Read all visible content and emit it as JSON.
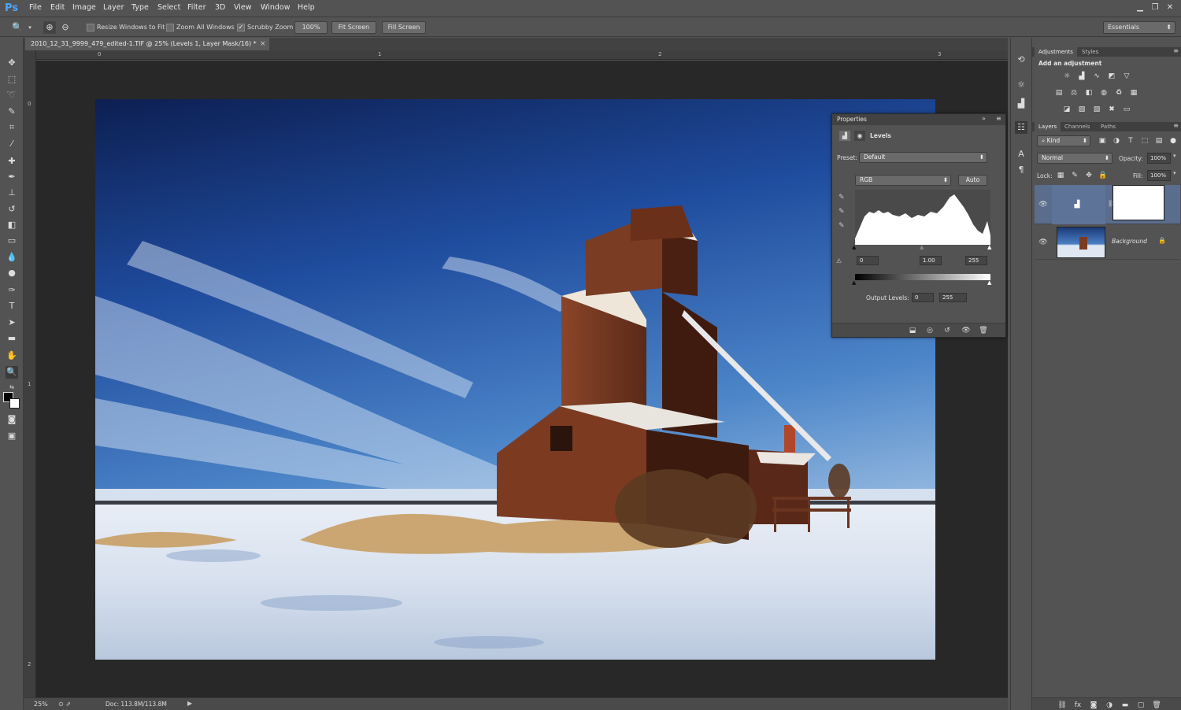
{
  "app": {
    "logo": "Ps"
  },
  "menu": [
    "File",
    "Edit",
    "Image",
    "Layer",
    "Type",
    "Select",
    "Filter",
    "3D",
    "View",
    "Window",
    "Help"
  ],
  "window_controls": [
    "minimize-icon",
    "restore-icon",
    "close-icon"
  ],
  "options": {
    "resize_windows": "Resize Windows to Fit",
    "zoom_all": "Zoom All Windows",
    "scrubby_zoom": "Scrubby Zoom",
    "zoom_pct": "100%",
    "fit_screen": "Fit Screen",
    "fill_screen": "Fill Screen",
    "workspace": "Essentials",
    "scrubby_checked": true
  },
  "document": {
    "tab_title": "2010_12_31_9999_479_edited-1.TIF @ 25% (Levels 1, Layer Mask/16) *",
    "close": "×"
  },
  "rulers": {
    "h": [
      "0",
      "1",
      "2",
      "3"
    ],
    "v": [
      "0",
      "1",
      "2"
    ]
  },
  "status": {
    "zoom": "25%",
    "doc": "Doc: 113.8M/113.8M"
  },
  "properties": {
    "title": "Properties",
    "adjustment": "Levels",
    "preset_label": "Preset:",
    "preset_value": "Default",
    "channel": "RGB",
    "auto": "Auto",
    "input_black": "0",
    "input_gamma": "1.00",
    "input_white": "255",
    "output_label": "Output Levels:",
    "output_black": "0",
    "output_white": "255"
  },
  "adjustments": {
    "tabs": [
      "Adjustments",
      "Styles"
    ],
    "heading": "Add an adjustment"
  },
  "layers": {
    "tabs": [
      "Layers",
      "Channels",
      "Paths"
    ],
    "kind": "Kind",
    "blend_mode": "Normal",
    "opacity_label": "Opacity:",
    "opacity": "100%",
    "lock_label": "Lock:",
    "fill_label": "Fill:",
    "fill": "100%",
    "items": [
      {
        "name": "",
        "type": "levels-adjustment"
      },
      {
        "name": "Background",
        "type": "image"
      }
    ]
  },
  "colors": {
    "accent": "#4aa7ff",
    "selected_layer": "#5a6d8c"
  }
}
